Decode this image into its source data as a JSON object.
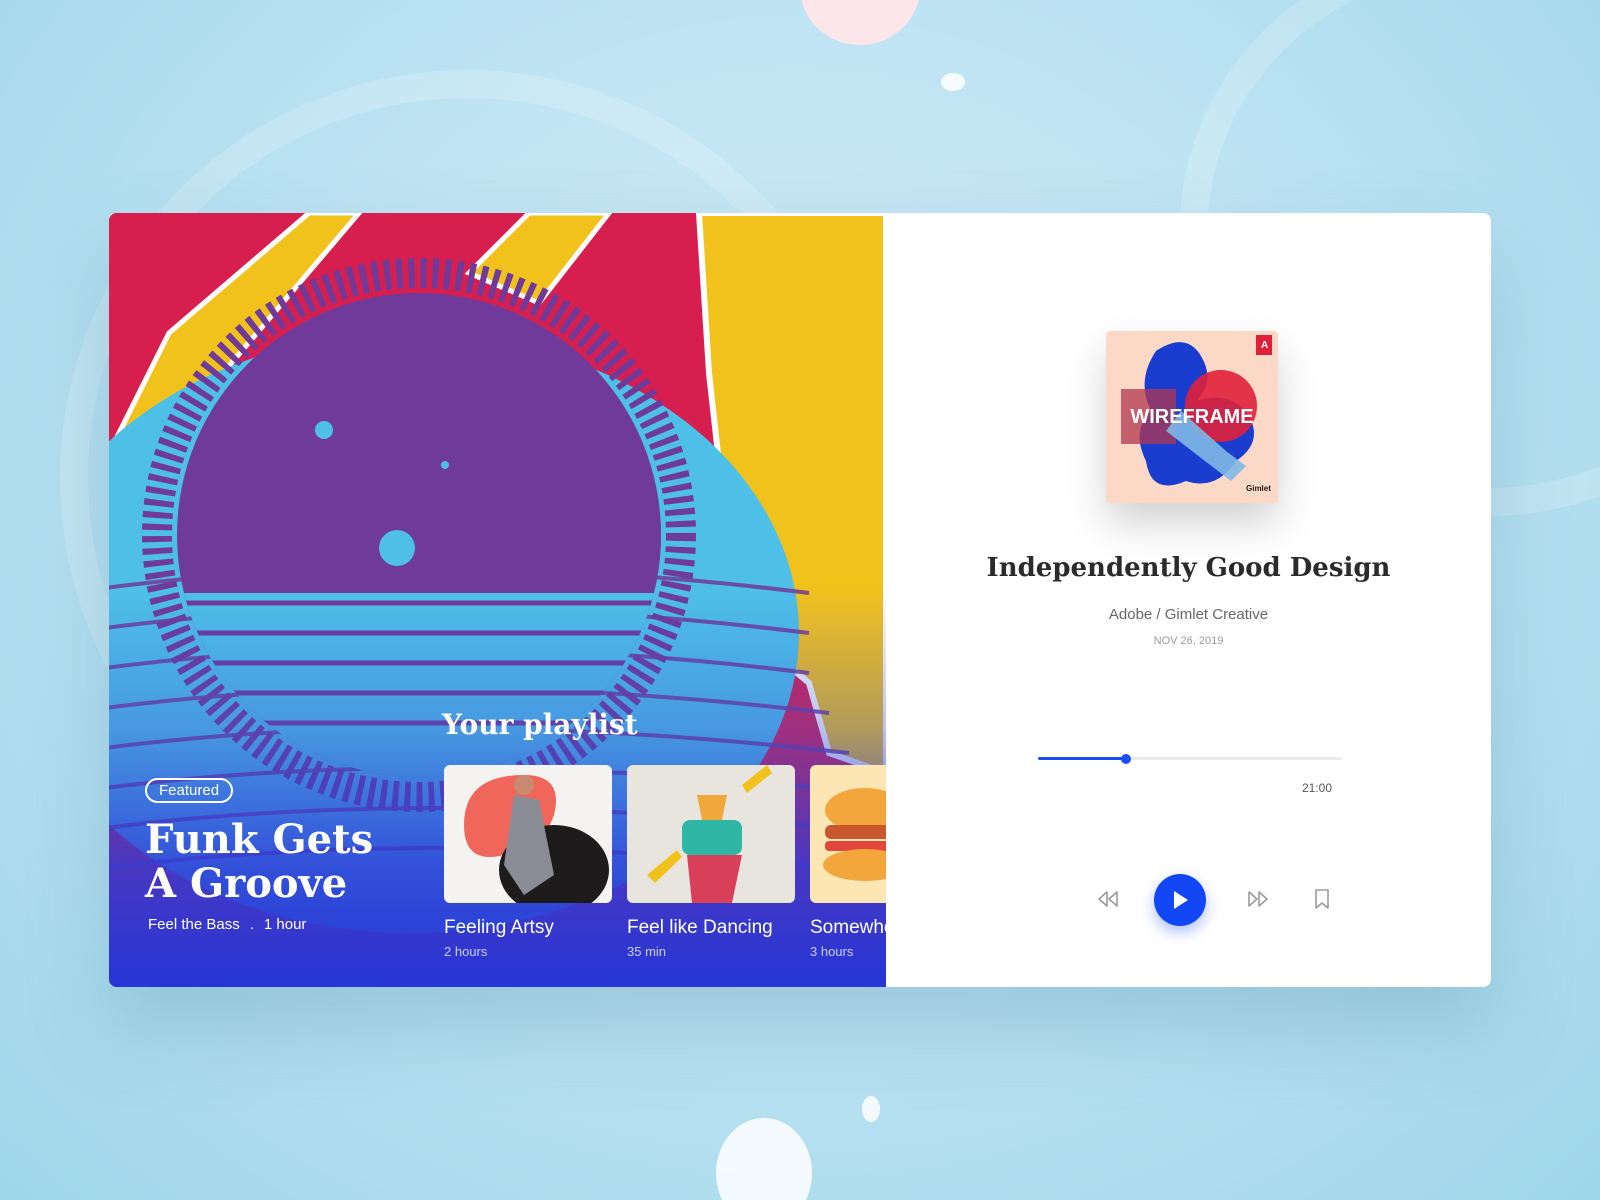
{
  "colors": {
    "accent": "#1a4ff5",
    "hero_red": "#d61f4f",
    "hero_yellow": "#f2c21c",
    "hero_purple": "#6f3a9a",
    "hero_blue": "#4ec0e8",
    "hero_gradient_bottom": "#2636d6"
  },
  "featured": {
    "badge": "Featured",
    "title_line1": "Funk Gets",
    "title_line2": "A Groove",
    "subtitle": "Feel the Bass",
    "separator": ".",
    "duration": "1 hour"
  },
  "playlist": {
    "heading": "Your playlist",
    "items": [
      {
        "name": "Feeling Artsy",
        "duration": "2 hours"
      },
      {
        "name": "Feel like Dancing",
        "duration": "35 min"
      },
      {
        "name": "Somewhere",
        "duration": "3 hours"
      }
    ]
  },
  "now_playing": {
    "cover_text": "WIREFRAME",
    "cover_badge": "Gimlet",
    "title": "Independently Good Design",
    "artist": "Adobe / Gimlet Creative",
    "date": "NOV 26, 2019",
    "progress_fraction": 0.29,
    "total_time": "21:00"
  },
  "controls": {
    "rewind_icon": "rewind-icon",
    "play_icon": "play-icon",
    "forward_icon": "fast-forward-icon",
    "bookmark_icon": "bookmark-icon"
  }
}
